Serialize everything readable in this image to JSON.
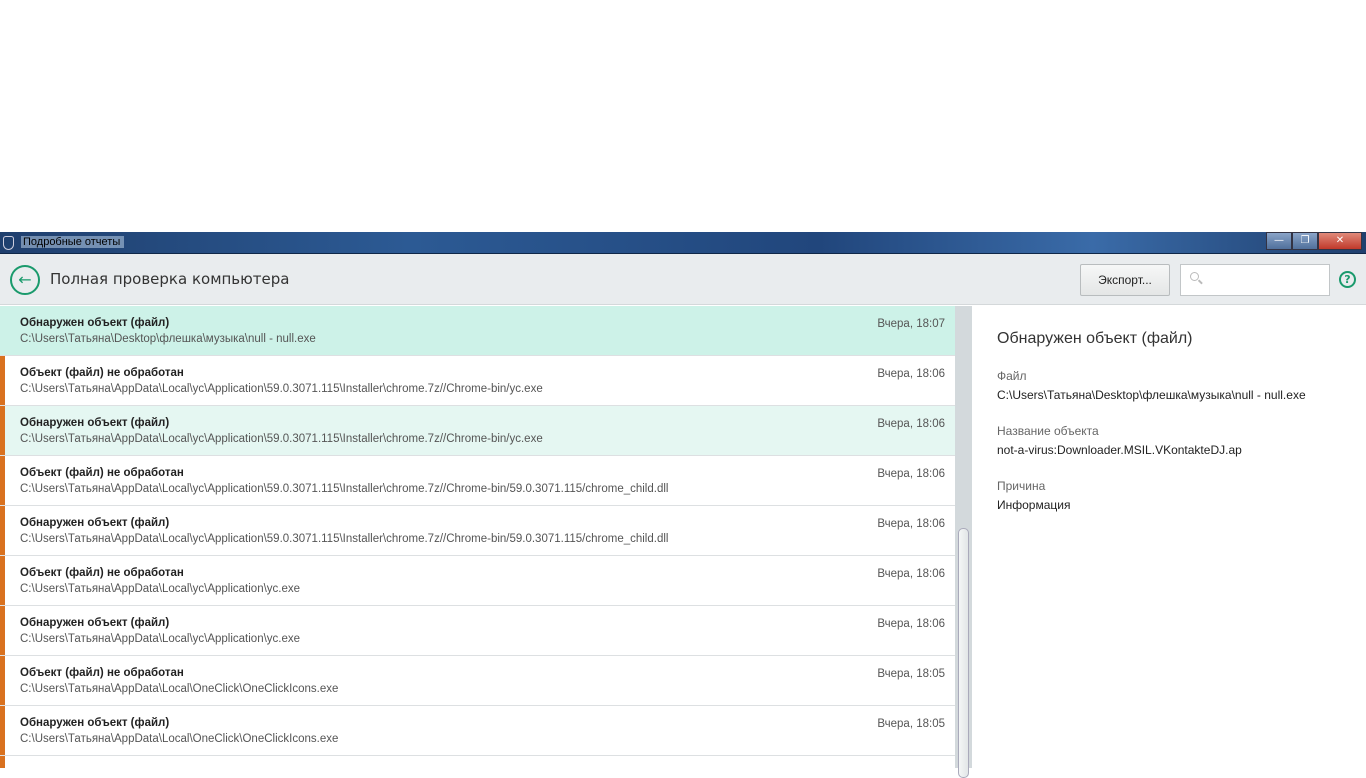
{
  "window": {
    "title": "Подробные отчеты",
    "buttons": [
      "minimize",
      "restore",
      "close"
    ]
  },
  "header": {
    "title": "Полная проверка компьютера",
    "export_label": "Экспорт...",
    "search_placeholder": "",
    "help_label": "?"
  },
  "colors": {
    "accent": "#1a9a6c",
    "warning_bar": "#d9711f",
    "selected_row": "#cdf2e8"
  },
  "list": [
    {
      "title": "Обнаружен объект (файл)",
      "path": "C:\\Users\\Татьяна\\Desktop\\флешка\\музыка\\null - null.exe",
      "date": "Вчера, 18:07",
      "state": "selected",
      "warning": false
    },
    {
      "title": "Объект (файл) не обработан",
      "path": "C:\\Users\\Татьяна\\AppData\\Local\\yc\\Application\\59.0.3071.115\\Installer\\chrome.7z//Chrome-bin/yc.exe",
      "date": "Вчера, 18:06",
      "state": "",
      "warning": true
    },
    {
      "title": "Обнаружен объект (файл)",
      "path": "C:\\Users\\Татьяна\\AppData\\Local\\yc\\Application\\59.0.3071.115\\Installer\\chrome.7z//Chrome-bin/yc.exe",
      "date": "Вчера, 18:06",
      "state": "hover",
      "warning": true
    },
    {
      "title": "Объект (файл) не обработан",
      "path": "C:\\Users\\Татьяна\\AppData\\Local\\yc\\Application\\59.0.3071.115\\Installer\\chrome.7z//Chrome-bin/59.0.3071.115/chrome_child.dll",
      "date": "Вчера, 18:06",
      "state": "",
      "warning": true
    },
    {
      "title": "Обнаружен объект (файл)",
      "path": "C:\\Users\\Татьяна\\AppData\\Local\\yc\\Application\\59.0.3071.115\\Installer\\chrome.7z//Chrome-bin/59.0.3071.115/chrome_child.dll",
      "date": "Вчера, 18:06",
      "state": "",
      "warning": true
    },
    {
      "title": "Объект (файл) не обработан",
      "path": "C:\\Users\\Татьяна\\AppData\\Local\\yc\\Application\\yc.exe",
      "date": "Вчера, 18:06",
      "state": "",
      "warning": true
    },
    {
      "title": "Обнаружен объект (файл)",
      "path": "C:\\Users\\Татьяна\\AppData\\Local\\yc\\Application\\yc.exe",
      "date": "Вчера, 18:06",
      "state": "",
      "warning": true
    },
    {
      "title": "Объект (файл) не обработан",
      "path": "C:\\Users\\Татьяна\\AppData\\Local\\OneClick\\OneClickIcons.exe",
      "date": "Вчера, 18:05",
      "state": "",
      "warning": true
    },
    {
      "title": "Обнаружен объект (файл)",
      "path": "C:\\Users\\Татьяна\\AppData\\Local\\OneClick\\OneClickIcons.exe",
      "date": "Вчера, 18:05",
      "state": "",
      "warning": true
    },
    {
      "title": "",
      "path": "",
      "date": "",
      "state": "",
      "warning": true
    }
  ],
  "detail": {
    "title": "Обнаружен объект (файл)",
    "fields": [
      {
        "label": "Файл",
        "value": "C:\\Users\\Татьяна\\Desktop\\флешка\\музыка\\null - null.exe"
      },
      {
        "label": "Название объекта",
        "value": "not-a-virus:Downloader.MSIL.VKontakteDJ.ap"
      },
      {
        "label": "Причина",
        "value": "Информация"
      }
    ]
  }
}
